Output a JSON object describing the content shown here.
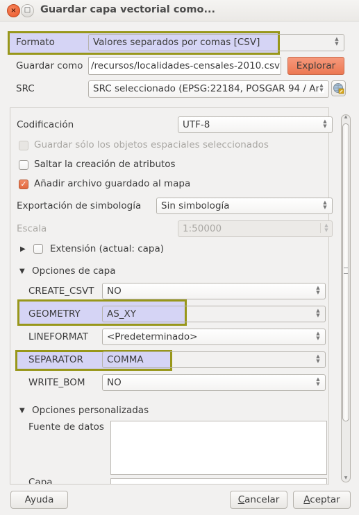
{
  "window": {
    "title": "Guardar capa vectorial como...",
    "close_glyph": "×",
    "maximize_glyph": "□"
  },
  "top_form": {
    "format_label": "Formato",
    "format_value": "Valores separados por comas [CSV]",
    "save_as_label": "Guardar como",
    "save_as_value": "/recursos/localidades-censales-2010.csv",
    "browse_button": "Explorar",
    "crs_label": "SRC",
    "crs_value": "SRC seleccionado (EPSG:22184, POSGAR 94 / Ar",
    "crs_button_icon": "crs-selector-icon"
  },
  "panel": {
    "encoding_label": "Codificación",
    "encoding_value": "UTF-8",
    "only_selected_label": "Guardar sólo los objetos espaciales seleccionados",
    "only_selected_checked": false,
    "only_selected_enabled": false,
    "skip_attributes_label": "Saltar la creación de atributos",
    "skip_attributes_checked": false,
    "add_to_map_label": "Añadir archivo guardado al mapa",
    "add_to_map_checked": true,
    "symbology_label": "Exportación de simbología",
    "symbology_value": "Sin simbología",
    "scale_label": "Escala",
    "scale_value": "1:50000",
    "extent_label": "Extensión (actual: capa)",
    "extent_checked": false,
    "layer_options_label": "Opciones de capa",
    "layer_options": [
      {
        "key": "CREATE_CSVT",
        "value": "NO",
        "highlighted": false
      },
      {
        "key": "GEOMETRY",
        "value": "AS_XY",
        "highlighted": true
      },
      {
        "key": "LINEFORMAT",
        "value": "<Predeterminado>",
        "highlighted": false
      },
      {
        "key": "SEPARATOR",
        "value": "COMMA",
        "highlighted": true
      },
      {
        "key": "WRITE_BOM",
        "value": "NO",
        "highlighted": false
      }
    ],
    "custom_options_label": "Opciones personalizadas",
    "datasource_label": "Fuente de datos",
    "datasource_value": "",
    "layer_label": "Capa",
    "layer_value": ""
  },
  "footer": {
    "help_button": "Ayuda",
    "cancel_button_mnemonic": "C",
    "cancel_button_rest": "ancelar",
    "accept_button_mnemonic": "A",
    "accept_button_rest": "ceptar"
  },
  "colors": {
    "highlight_border": "#98971a",
    "highlight_fill": "#bebcfa",
    "accent_orange": "#ec7852"
  }
}
